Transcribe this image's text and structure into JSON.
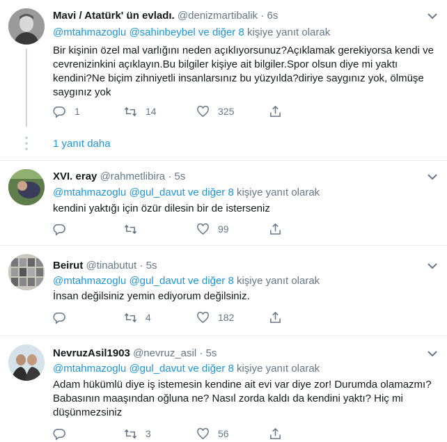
{
  "tweets": [
    {
      "name": "Mavi / Atatürk' ün evladı.",
      "handle": "@denizmartibalik",
      "time": "6s",
      "reply_to_1": "@mtahmazoglu",
      "reply_to_2": "@sahinbeybel",
      "reply_and": "ve",
      "reply_others": "diğer 8",
      "reply_suffix": "kişiye yanıt olarak",
      "text": "Bir kişinin özel mal varlığını neden açıklıyorsunuz?Açıklamak gerekiyorsa kendi ve cevrenizinkini açıklayın.Bu bilgiler kişiye ait bilgiler.Spor olsun diye mi yaktı kendini?Ne biçim zihniyetli insanlarsınız bu yüzyılda?diriye saygınız yok, ölmüşe saygınız yok",
      "replies": "1",
      "retweets": "14",
      "likes": "325"
    },
    {
      "name": "XVI. eray",
      "handle": "@rahmetlibira",
      "time": "5s",
      "reply_to_1": "@mtahmazoglu",
      "reply_to_2": "@gul_davut",
      "reply_and": "ve",
      "reply_others": "diğer 8",
      "reply_suffix": "kişiye yanıt olarak",
      "text": "kendini yaktığı için özür dilesin bir de isterseniz",
      "replies": "",
      "retweets": "",
      "likes": "99"
    },
    {
      "name": "Beirut",
      "handle": "@tinabutut",
      "time": "5s",
      "reply_to_1": "@mtahmazoglu",
      "reply_to_2": "@gul_davut",
      "reply_and": "ve",
      "reply_others": "diğer 8",
      "reply_suffix": "kişiye yanıt olarak",
      "text": "İnsan değilsiniz yemin ediyorum değilsiniz.",
      "replies": "",
      "retweets": "4",
      "likes": "182"
    },
    {
      "name": "NevruzAsil1903",
      "handle": "@nevruz_asil",
      "time": "5s",
      "reply_to_1": "@mtahmazoglu",
      "reply_to_2": "@gul_davut",
      "reply_and": "ve",
      "reply_others": "diğer 8",
      "reply_suffix": "kişiye yanıt olarak",
      "text": "Adam hükümlü diye iş istemesin kendine ait evi var diye zor! Durumda olamazmı? Babasının maaşından oğluna ne? Nasıl zorda kaldı da kendini yaktı? Hiç mi düşünmezsiniz",
      "replies": "",
      "retweets": "3",
      "likes": "56"
    }
  ],
  "show_more": "1 yanıt daha",
  "separator": "·",
  "colors": {
    "link": "#1b95e0",
    "muted": "#657786",
    "text": "#14171a",
    "border": "#e6ecf0"
  },
  "icons": {
    "reply": "reply-icon",
    "retweet": "retweet-icon",
    "like": "heart-icon",
    "share": "share-icon",
    "menu": "chevron-down-icon"
  }
}
